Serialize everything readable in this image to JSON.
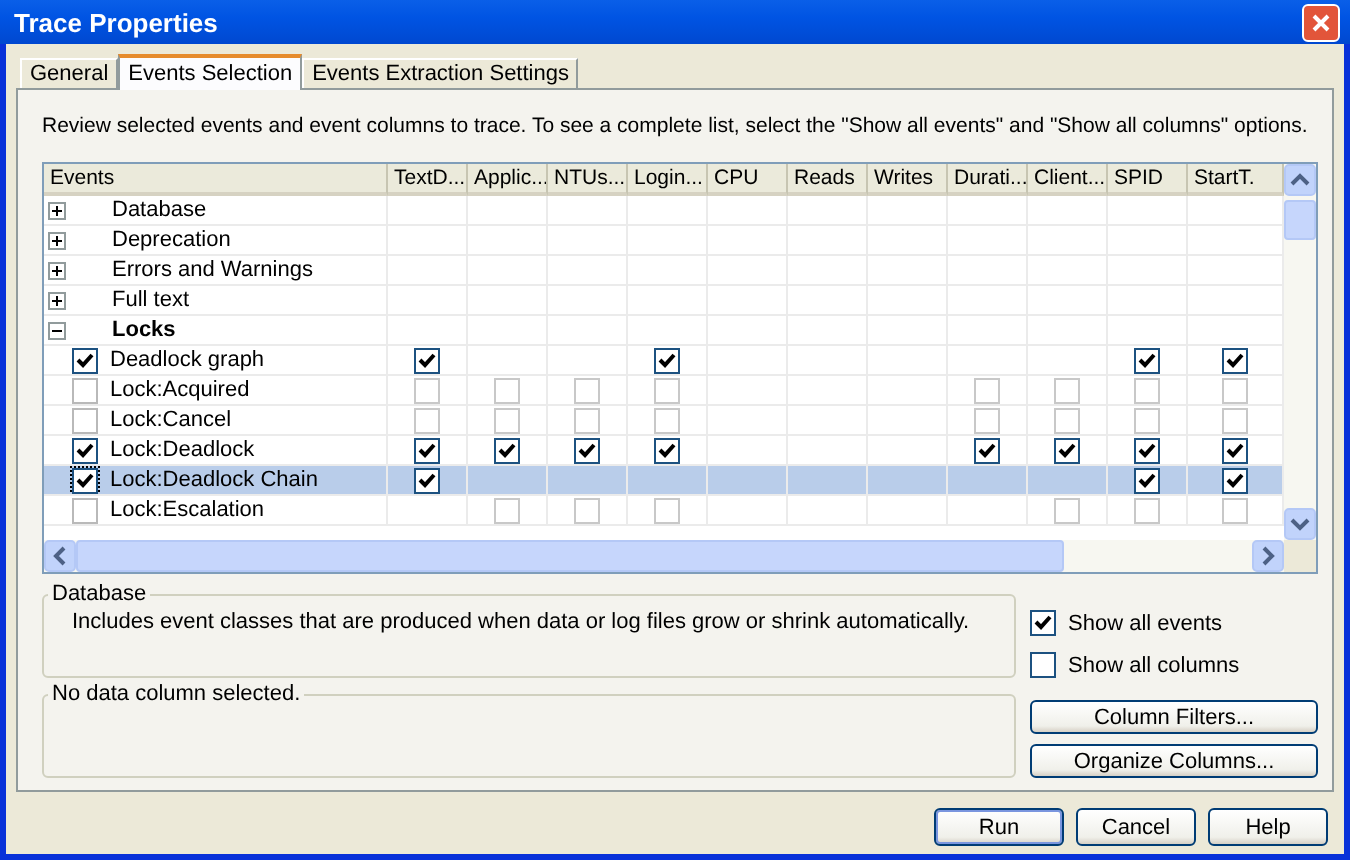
{
  "window": {
    "title": "Trace Properties"
  },
  "tabs": [
    {
      "label": "General",
      "selected": false
    },
    {
      "label": "Events Selection",
      "selected": true
    },
    {
      "label": "Events Extraction Settings",
      "selected": false
    }
  ],
  "description": "Review selected events and event columns to trace. To see a complete list, select the \"Show all events\" and \"Show all columns\" options.",
  "grid": {
    "columns": [
      "Events",
      "TextD...",
      "Applic...",
      "NTUs...",
      "Login...",
      "CPU",
      "Reads",
      "Writes",
      "Durati...",
      "Client...",
      "SPID",
      "StartT."
    ],
    "rows": [
      {
        "kind": "category",
        "label": "Database",
        "expanded": false,
        "selected": false
      },
      {
        "kind": "category",
        "label": "Deprecation",
        "expanded": false,
        "selected": false
      },
      {
        "kind": "category",
        "label": "Errors and Warnings",
        "expanded": false,
        "selected": false
      },
      {
        "kind": "category",
        "label": "Full text",
        "expanded": false,
        "selected": false
      },
      {
        "kind": "category",
        "label": "Locks",
        "expanded": true,
        "selected": false
      },
      {
        "kind": "event",
        "label": "Deadlock graph",
        "checked": true,
        "selected": false,
        "cells": [
          true,
          null,
          null,
          true,
          null,
          null,
          null,
          null,
          null,
          true,
          true
        ]
      },
      {
        "kind": "event",
        "label": "Lock:Acquired",
        "checked": false,
        "selected": false,
        "cells": [
          false,
          false,
          false,
          false,
          null,
          null,
          null,
          false,
          false,
          false,
          false
        ]
      },
      {
        "kind": "event",
        "label": "Lock:Cancel",
        "checked": false,
        "selected": false,
        "cells": [
          false,
          false,
          false,
          false,
          null,
          null,
          null,
          false,
          false,
          false,
          false
        ]
      },
      {
        "kind": "event",
        "label": "Lock:Deadlock",
        "checked": true,
        "selected": false,
        "cells": [
          true,
          true,
          true,
          true,
          null,
          null,
          null,
          true,
          true,
          true,
          true
        ]
      },
      {
        "kind": "event",
        "label": "Lock:Deadlock Chain",
        "checked": true,
        "selected": true,
        "cells": [
          true,
          null,
          null,
          null,
          null,
          null,
          null,
          null,
          null,
          true,
          true
        ]
      },
      {
        "kind": "event",
        "label": "Lock:Escalation",
        "checked": false,
        "selected": false,
        "cells": [
          null,
          false,
          false,
          false,
          null,
          null,
          null,
          null,
          false,
          false,
          false
        ]
      }
    ]
  },
  "event_info": {
    "title": "Database",
    "text": "Includes event classes that are produced when data or log files grow or shrink automatically."
  },
  "column_info": {
    "title": "No data column selected."
  },
  "options": [
    {
      "label": "Show all events",
      "checked": true
    },
    {
      "label": "Show all columns",
      "checked": false
    }
  ],
  "side_buttons": [
    "Column Filters...",
    "Organize Columns..."
  ],
  "buttons": [
    {
      "label": "Run",
      "default": true
    },
    {
      "label": "Cancel",
      "default": false
    },
    {
      "label": "Help",
      "default": false
    }
  ]
}
